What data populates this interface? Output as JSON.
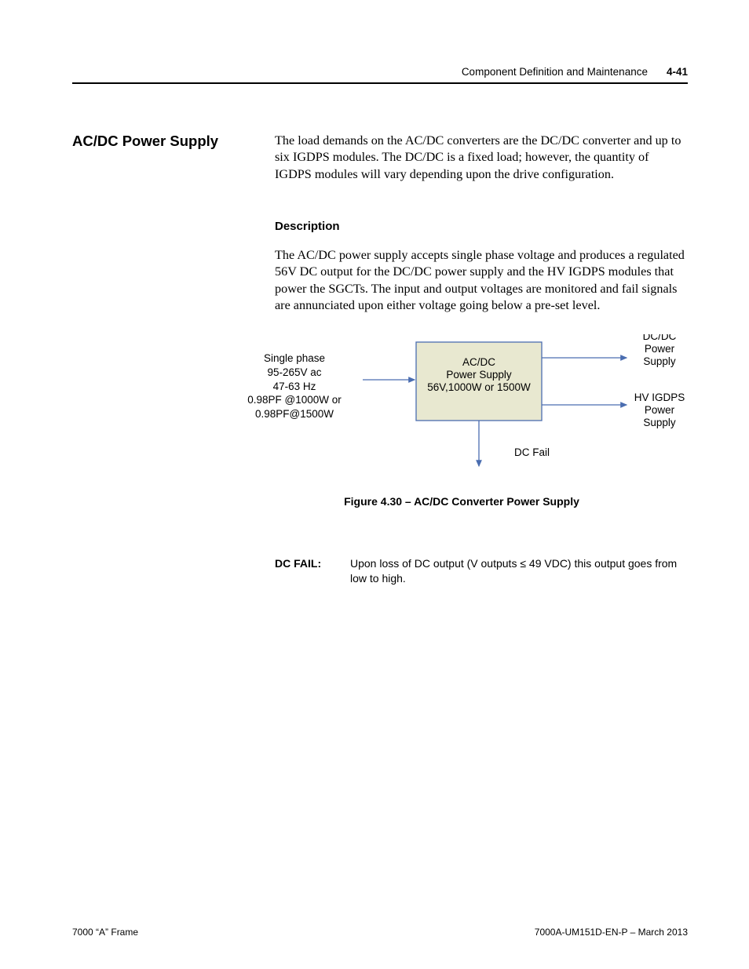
{
  "header": {
    "section_title": "Component Definition and Maintenance",
    "page_number": "4-41"
  },
  "section": {
    "heading": "AC/DC Power Supply",
    "intro": "The load demands on the AC/DC converters are the DC/DC converter and up to six IGDPS modules.  The DC/DC is a fixed load; however, the quantity of IGDPS modules will vary depending upon the drive configuration.",
    "sub_heading": "Description",
    "description": "The AC/DC power supply accepts single phase voltage and produces a regulated 56V DC output for the DC/DC power supply and the HV IGDPS modules that power the SGCTs.  The input and output voltages are monitored and fail signals are annunciated upon either voltage going below a pre-set level."
  },
  "figure": {
    "input_lines": [
      "Single phase",
      "95-265V ac",
      "47-63 Hz",
      "0.98PF @1000W or",
      "0.98PF@1500W"
    ],
    "box_lines": [
      "AC/DC",
      "Power Supply",
      "56V,1000W or 1500W"
    ],
    "out_top": [
      "DC/DC",
      "Power",
      "Supply"
    ],
    "out_bottom": [
      "HV IGDPS",
      "Power",
      "Supply"
    ],
    "dc_fail": "DC Fail",
    "caption": "Figure 4.30 – AC/DC Converter Power Supply"
  },
  "dcfail": {
    "label": "DC FAIL:",
    "text": "Upon loss of DC output (V outputs ≤ 49 VDC) this output goes from low to high."
  },
  "footer": {
    "left": "7000 “A” Frame",
    "right": "7000A-UM151D-EN-P – March 2013"
  }
}
